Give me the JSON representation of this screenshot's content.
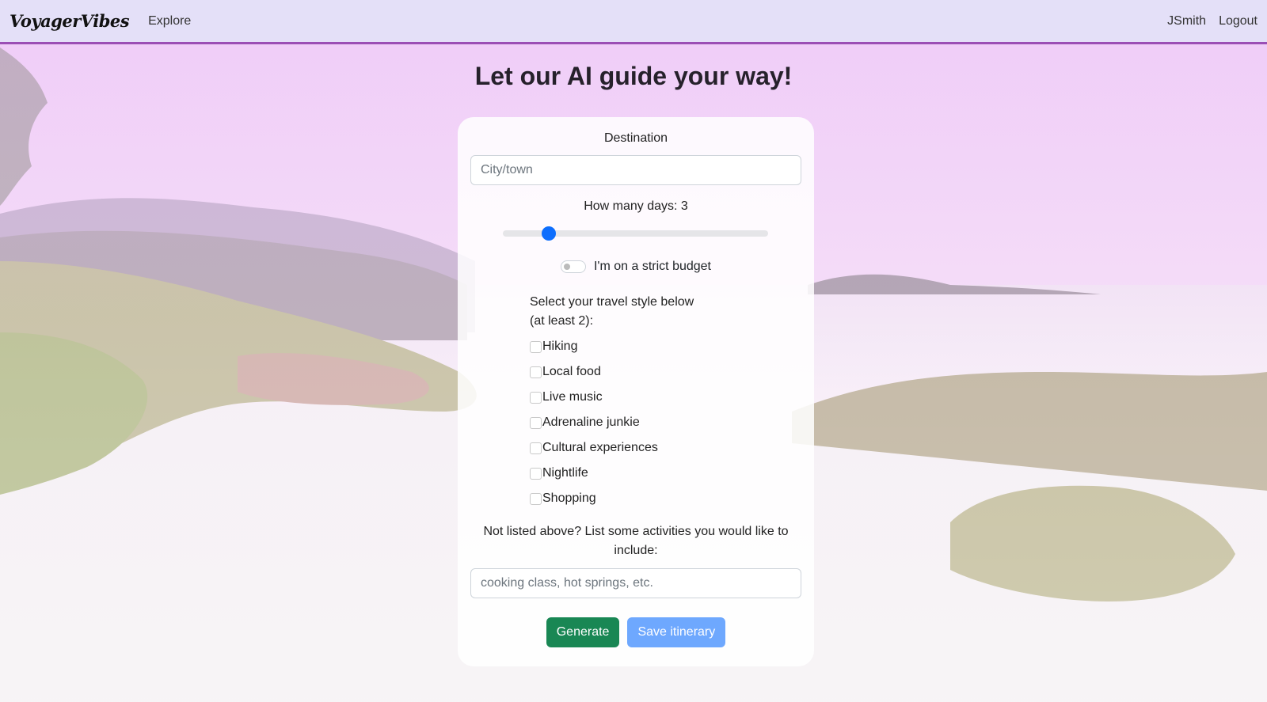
{
  "navbar": {
    "brand": "VoyagerVibes",
    "explore_label": "Explore",
    "username": "JSmith",
    "logout_label": "Logout"
  },
  "page": {
    "title": "Let our AI guide your way!"
  },
  "form": {
    "destination_label": "Destination",
    "destination_placeholder": "City/town",
    "destination_value": "",
    "days_label": "How many days: 3",
    "days": {
      "min": 1,
      "max": 14,
      "value": 3
    },
    "budget_label": "I'm on a strict budget",
    "budget_checked": false,
    "style_label_line1": "Select your travel style below",
    "style_label_line2": "(at least 2):",
    "styles": [
      {
        "label": "Hiking",
        "checked": false
      },
      {
        "label": "Local food",
        "checked": false
      },
      {
        "label": "Live music",
        "checked": false
      },
      {
        "label": "Adrenaline junkie",
        "checked": false
      },
      {
        "label": "Cultural experiences",
        "checked": false
      },
      {
        "label": "Nightlife",
        "checked": false
      },
      {
        "label": "Shopping",
        "checked": false
      }
    ],
    "extra_label": "Not listed above? List some activities you would like to include:",
    "extra_placeholder": "cooking class, hot springs, etc.",
    "generate_label": "Generate",
    "save_label": "Save itinerary"
  },
  "colors": {
    "navbar_bg": "#e4e0f8",
    "navbar_border": "#9b4fb5",
    "primary": "#0d6efd",
    "generate": "#198754",
    "save": "#6ea8fe"
  }
}
